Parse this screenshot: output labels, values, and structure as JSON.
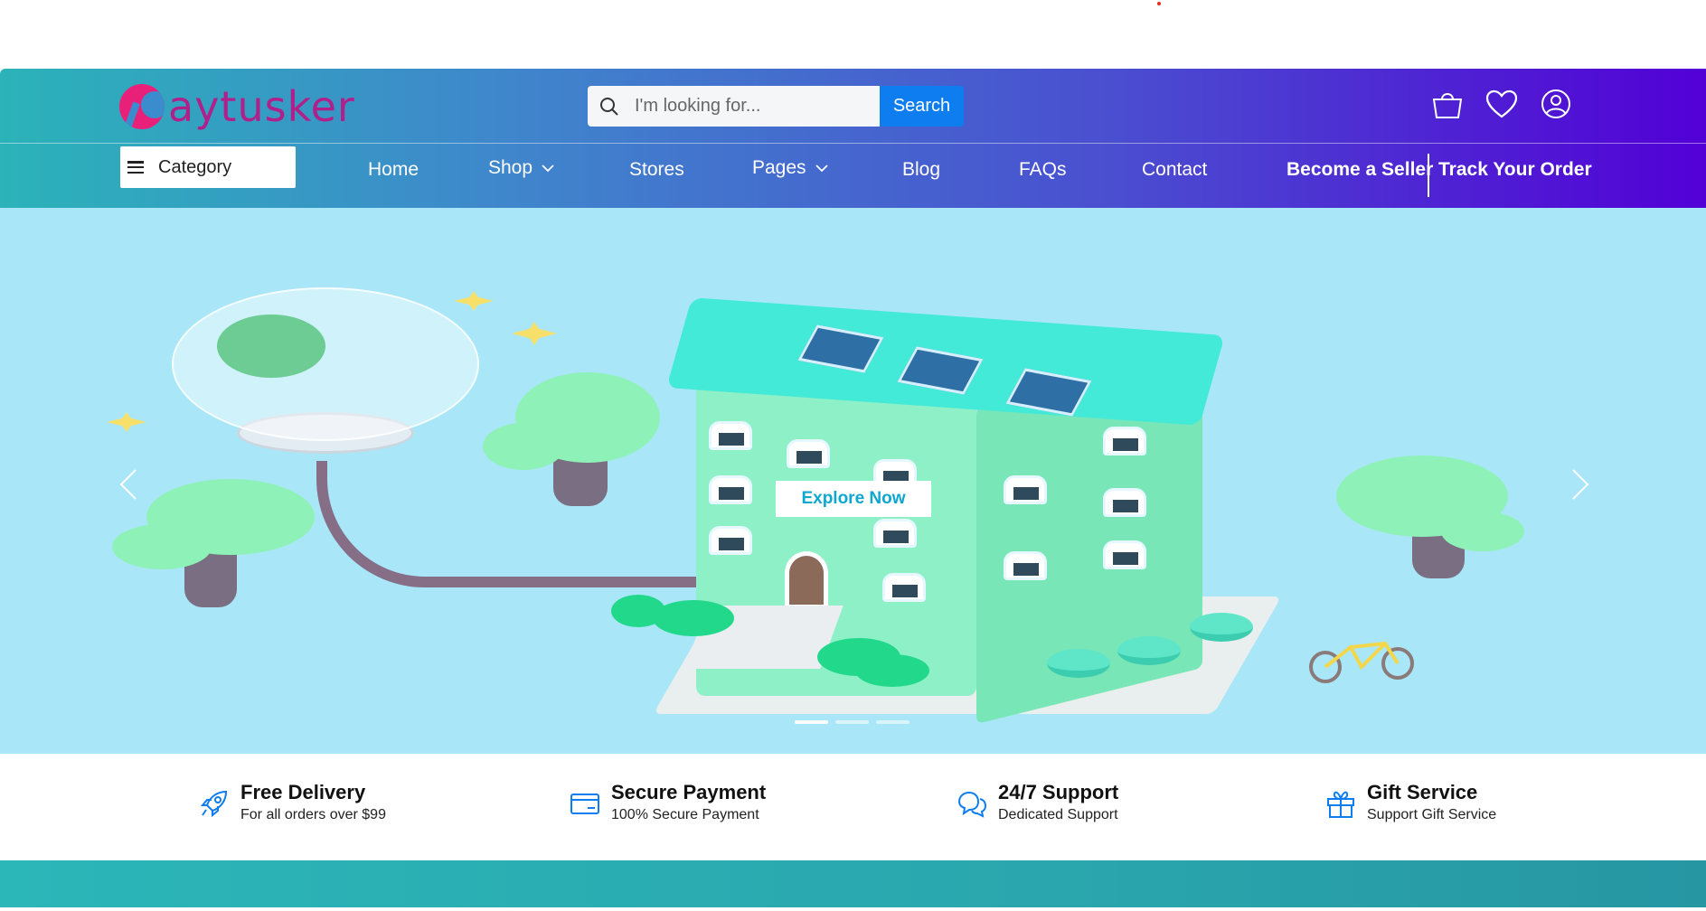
{
  "brand": {
    "name": "aytusker"
  },
  "search": {
    "placeholder": "I'm looking for...",
    "button_label": "Search"
  },
  "header_icons": [
    "shopping-bag-icon",
    "heart-icon",
    "user-icon"
  ],
  "category": {
    "label": "Category"
  },
  "nav": {
    "home": "Home",
    "shop": "Shop",
    "stores": "Stores",
    "pages": "Pages",
    "blog": "Blog",
    "faqs": "FAQs",
    "contact": "Contact",
    "become_seller": "Become a Seller",
    "track_order": "Track Your Order"
  },
  "hero": {
    "cta_label": "Explore Now",
    "slides": 3,
    "active_slide": 1
  },
  "features": [
    {
      "title": "Free Delivery",
      "subtitle": "For all orders over $99",
      "icon": "rocket-icon"
    },
    {
      "title": "Secure Payment",
      "subtitle": "100% Secure Payment",
      "icon": "credit-card-icon"
    },
    {
      "title": "24/7 Support",
      "subtitle": "Dedicated Support",
      "icon": "chat-icon"
    },
    {
      "title": "Gift Service",
      "subtitle": "Support Gift Service",
      "icon": "gift-icon"
    }
  ],
  "colors": {
    "header_gradient_start": "#2bb3b9",
    "header_gradient_end": "#5200d6",
    "search_button": "#0d7df0",
    "hero_background": "#a9e7f8",
    "feature_icon": "#0d7df0",
    "logo": "#b0208a"
  }
}
